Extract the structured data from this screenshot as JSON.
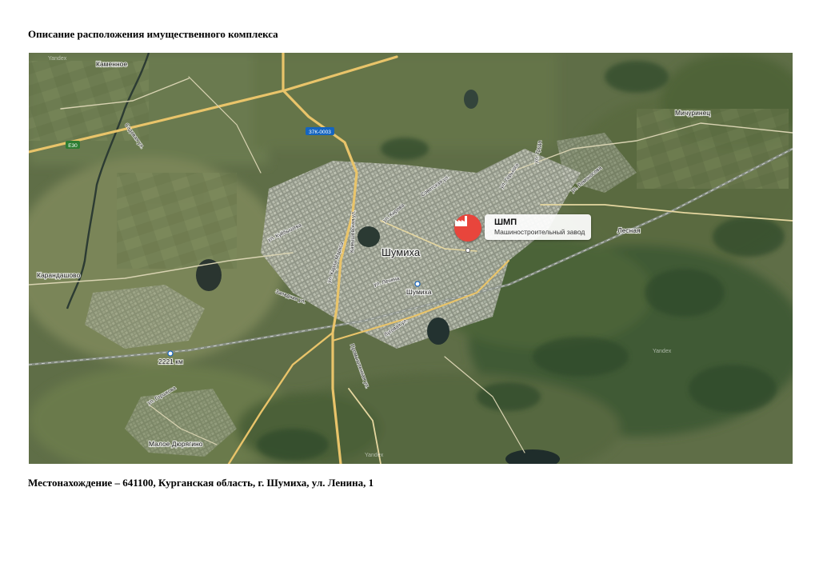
{
  "document": {
    "heading": "Описание расположения имущественного комплекса",
    "footer": "Местонахождение – 641100, Курганская область, г. Шумиха, ул. Ленина, 1"
  },
  "map": {
    "watermark": "Yandex",
    "poi": {
      "title": "ШМП",
      "subtitle": "Машиностроительный завод",
      "icon": "factory-icon",
      "color": "#e8453c"
    },
    "places": {
      "town": "Шумиха",
      "station": "Шумиха",
      "kamennoe": "Каменное",
      "michurinets": "Мичуринец",
      "lesnaya": "Лесная",
      "karandashovo": "Карандашово",
      "maloe_dyuryagino": "Малое Дюрягино",
      "km_marker": "2221 км"
    },
    "streets": {
      "lenina": "ул. Ленина",
      "kirova": "ул. Кирова",
      "karla_marksa": "ул. Карла Маркса",
      "kuybysheva": "ул. Куйбышева",
      "zapadnaya": "Западная ул.",
      "kamyshevskaya": "Камышевская ул.",
      "gorkogo": "ул. Горького",
      "kalinina": "ул. Калинина",
      "sovetskaya": "Советская ул.",
      "promyshlennaya": "Промышленная ул.",
      "lugovaya": "Луговая ул.",
      "trudovaya": "ул. Труда",
      "lomonosova": "ул. Ломоносова",
      "sadovaya": "Садовая ул.",
      "gorshkova": "ул. Горшкова"
    },
    "road_shields": {
      "e30": "E30",
      "r37k": "37К-0003"
    }
  }
}
